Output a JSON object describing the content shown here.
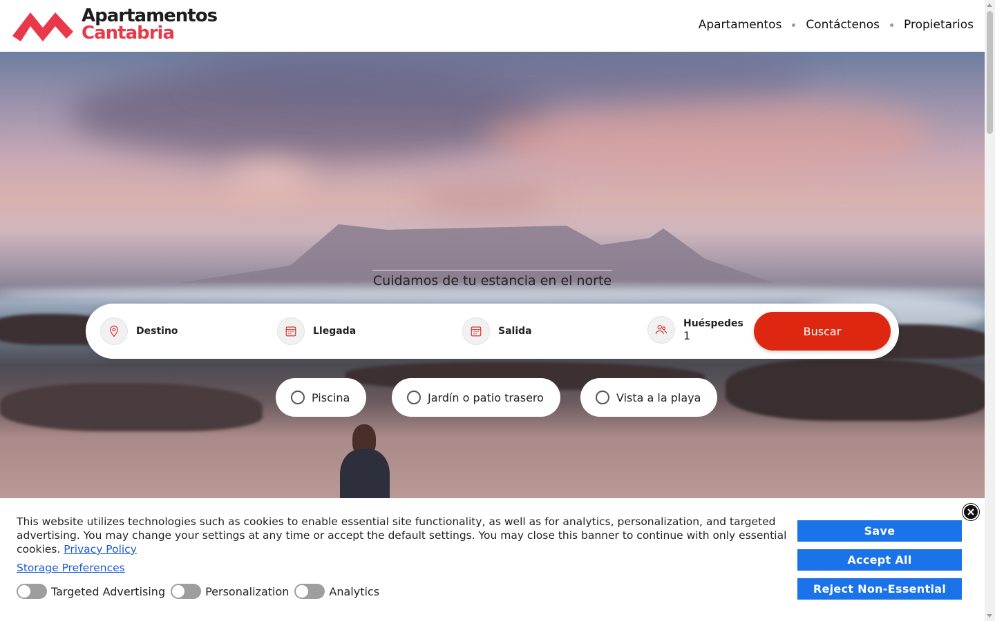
{
  "header": {
    "logo": {
      "line1": "Apartamentos",
      "line2": "Cantabria",
      "brand_color": "#e8384a"
    },
    "nav": [
      {
        "label": "Apartamentos"
      },
      {
        "label": "Contáctenos"
      },
      {
        "label": "Propietarios"
      }
    ]
  },
  "hero": {
    "tagline": "Cuidamos de tu estancia en el norte"
  },
  "search": {
    "destination": {
      "label": "Destino",
      "icon": "location-pin-icon"
    },
    "checkin": {
      "label": "Llegada",
      "icon": "calendar-icon"
    },
    "checkout": {
      "label": "Salida",
      "icon": "calendar-icon"
    },
    "guests": {
      "label": "Huéspedes",
      "value": "1",
      "icon": "guests-icon"
    },
    "button": "Buscar",
    "accent": "#dd2711"
  },
  "filters": [
    {
      "label": "Piscina",
      "checked": false
    },
    {
      "label": "Jardín o patio trasero",
      "checked": false
    },
    {
      "label": "Vista a la playa",
      "checked": false
    }
  ],
  "cookie_banner": {
    "text": "This website utilizes technologies such as cookies to enable essential site functionality, as well as for analytics, personalization, and targeted advertising. You may change your settings at any time or accept the default settings. You may close this banner to continue with only essential cookies.",
    "privacy_link": "Privacy Policy",
    "storage_link": "Storage Preferences",
    "toggles": [
      {
        "label": "Targeted Advertising",
        "on": false
      },
      {
        "label": "Personalization",
        "on": false
      },
      {
        "label": "Analytics",
        "on": false
      }
    ],
    "buttons": {
      "save": "Save",
      "accept": "Accept All",
      "reject": "Reject Non-Essential"
    },
    "button_color": "#1a73e8"
  }
}
